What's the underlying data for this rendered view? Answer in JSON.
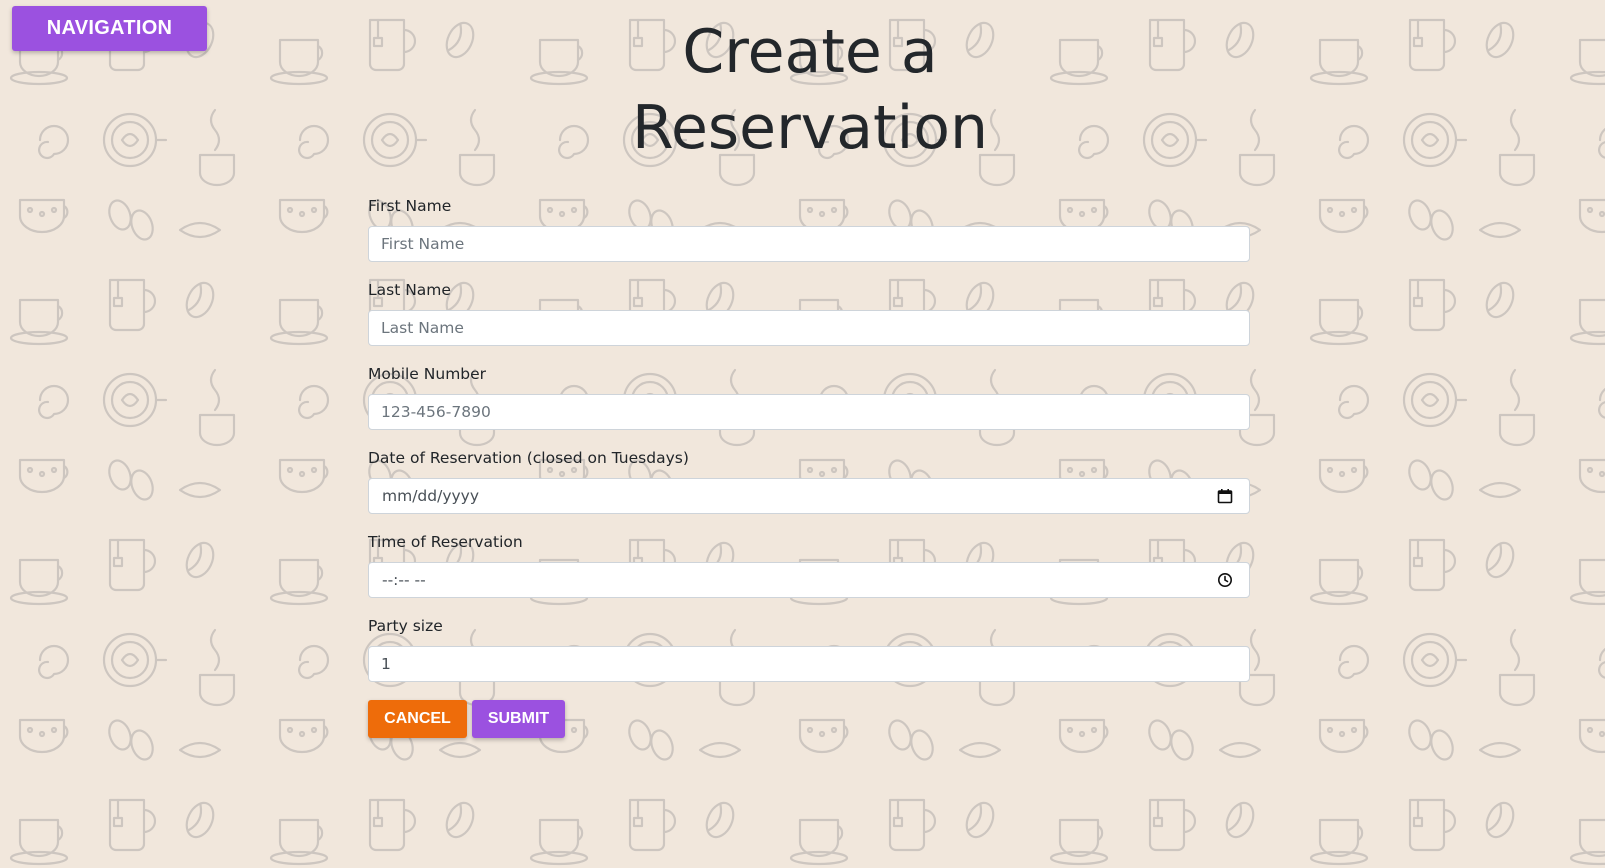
{
  "nav": {
    "button_label": "NAVIGATION"
  },
  "page": {
    "title": "Create a Reservation"
  },
  "form": {
    "first_name": {
      "label": "First Name",
      "placeholder": "First Name"
    },
    "last_name": {
      "label": "Last Name",
      "placeholder": "Last Name"
    },
    "mobile": {
      "label": "Mobile Number",
      "placeholder": "123-456-7890"
    },
    "date": {
      "label": "Date of Reservation (closed on Tuesdays)",
      "placeholder": "mm/dd/yyyy",
      "icon": "calendar-icon"
    },
    "time": {
      "label": "Time of Reservation",
      "placeholder": "--:-- --",
      "icon": "clock-icon"
    },
    "party_size": {
      "label": "Party size",
      "value": "1"
    }
  },
  "actions": {
    "cancel_label": "CANCEL",
    "submit_label": "SUBMIT"
  },
  "colors": {
    "background": "#f1e7dc",
    "pattern": "#cdc6c0",
    "nav_button": "#9b51e0",
    "cancel_button": "#ee6c0a",
    "submit_button": "#9b51e0",
    "title_text": "#23272b"
  }
}
